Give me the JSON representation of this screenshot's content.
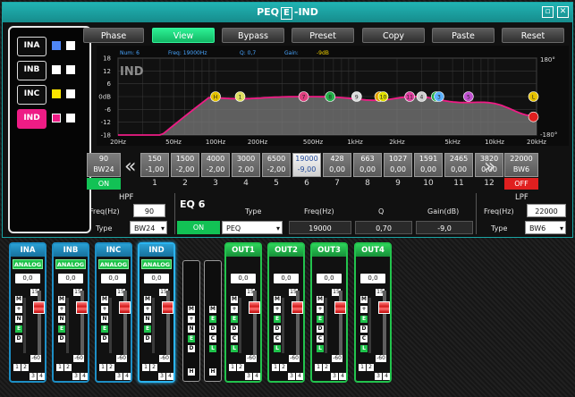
{
  "window": {
    "title_prefix": "PEQ",
    "title_box": "E",
    "title_suffix": "-IND",
    "restore_icon": "restore-icon",
    "close_icon": "close-icon"
  },
  "channels": [
    {
      "label": "INA",
      "color1": "#4f86f7",
      "color2": "#ffffff",
      "active": false
    },
    {
      "label": "INB",
      "color1": "#ffffff",
      "color2": "#ffffff",
      "active": false
    },
    {
      "label": "INC",
      "color1": "#ffe600",
      "color2": "#ffffff",
      "active": false
    },
    {
      "label": "IND",
      "color1": "#ee1c85",
      "color2": "#ffffff",
      "active": true
    }
  ],
  "toolbar": {
    "phase": "Phase",
    "view": "View",
    "bypass": "Bypass",
    "preset": "Preset",
    "copy": "Copy",
    "paste": "Paste",
    "reset": "Reset"
  },
  "graph": {
    "label": "IND",
    "info": {
      "num": "Num: 6",
      "freq": "Freq: 19000Hz",
      "q": "Q: 0,7",
      "gain": "Gain:",
      "gain_val": "-9dB"
    },
    "y_labels": [
      "18",
      "12",
      "6",
      "0dB",
      "-6",
      "-12",
      "-18"
    ],
    "x_labels": [
      "20Hz",
      "50Hz",
      "100Hz",
      "200Hz",
      "500Hz",
      "1kHz",
      "2kHz",
      "5kHz",
      "10kHz",
      "20kHz"
    ],
    "phase_top": "180°",
    "phase_bottom": "-180°",
    "curve_color": "#ee1c85"
  },
  "bands": [
    {
      "freq": "150",
      "gain": "-1,00",
      "num": "1"
    },
    {
      "freq": "1500",
      "gain": "-2,00",
      "num": "2"
    },
    {
      "freq": "4000",
      "gain": "-2,00",
      "num": "3"
    },
    {
      "freq": "3000",
      "gain": "2,00",
      "num": "4"
    },
    {
      "freq": "6500",
      "gain": "-2,00",
      "num": "5"
    },
    {
      "freq": "19000",
      "gain": "-9,00",
      "num": "6"
    },
    {
      "freq": "428",
      "gain": "0,00",
      "num": "7"
    },
    {
      "freq": "663",
      "gain": "0,00",
      "num": "8"
    },
    {
      "freq": "1027",
      "gain": "0,00",
      "num": "9"
    },
    {
      "freq": "1591",
      "gain": "0,00",
      "num": "10"
    },
    {
      "freq": "2465",
      "gain": "0,00",
      "num": "11"
    },
    {
      "freq": "3820",
      "gain": "0,00",
      "num": "12"
    }
  ],
  "hp_end": {
    "freq": "90",
    "type": "BW24",
    "state": "ON"
  },
  "lp_end": {
    "freq": "22000",
    "type": "BW6",
    "state": "OFF"
  },
  "nav": {
    "prev": "«",
    "next": "»"
  },
  "hpf": {
    "title": "HPF",
    "freq_label": "Freq(Hz)",
    "freq": "90",
    "type_label": "Type",
    "type": "BW24"
  },
  "eq": {
    "title": "EQ 6",
    "state": "ON",
    "type_label": "Type",
    "type": "PEQ",
    "freq_label": "Freq(Hz)",
    "freq": "19000",
    "q_label": "Q",
    "q": "0,70",
    "gain_label": "Gain(dB)",
    "gain": "-9,0"
  },
  "lpf": {
    "title": "LPF",
    "freq_label": "Freq(Hz)",
    "freq": "22000",
    "type_label": "Type",
    "type": "BW6"
  },
  "strips": [
    {
      "name": "INA",
      "badge": "ANALOG",
      "value": "0,0",
      "kind": "in",
      "buttons": [
        "M",
        "+",
        "N",
        "E",
        "D"
      ]
    },
    {
      "name": "INB",
      "badge": "ANALOG",
      "value": "0,0",
      "kind": "in",
      "buttons": [
        "M",
        "+",
        "N",
        "E",
        "D"
      ]
    },
    {
      "name": "INC",
      "badge": "ANALOG",
      "value": "0,0",
      "kind": "in",
      "buttons": [
        "M",
        "+",
        "N",
        "E",
        "D"
      ]
    },
    {
      "name": "IND",
      "badge": "ANALOG",
      "value": "0,0",
      "kind": "in",
      "buttons": [
        "M",
        "+",
        "N",
        "E",
        "D"
      ]
    },
    {
      "name": "OUT1",
      "badge": "",
      "value": "0,0",
      "kind": "out",
      "buttons": [
        "M",
        "+",
        "E",
        "D",
        "C",
        "L"
      ]
    },
    {
      "name": "OUT2",
      "badge": "",
      "value": "0,0",
      "kind": "out",
      "buttons": [
        "M",
        "+",
        "E",
        "D",
        "C",
        "L"
      ]
    },
    {
      "name": "OUT3",
      "badge": "",
      "value": "0,0",
      "kind": "out",
      "buttons": [
        "M",
        "+",
        "E",
        "D",
        "C",
        "L"
      ]
    },
    {
      "name": "OUT4",
      "badge": "",
      "value": "0,0",
      "kind": "out",
      "buttons": [
        "M",
        "+",
        "E",
        "D",
        "C",
        "L"
      ]
    }
  ],
  "strip_scale": {
    "top": "15",
    "bottom": "-60"
  },
  "strip_sources": [
    "1",
    "2",
    "3",
    "4"
  ],
  "narrow_left": {
    "buttons": [
      "M",
      "+",
      "N",
      "E",
      "D"
    ],
    "footer": "H"
  },
  "narrow_right": {
    "buttons": [
      "M",
      "E",
      "D",
      "C",
      "L"
    ],
    "footer": "H"
  }
}
